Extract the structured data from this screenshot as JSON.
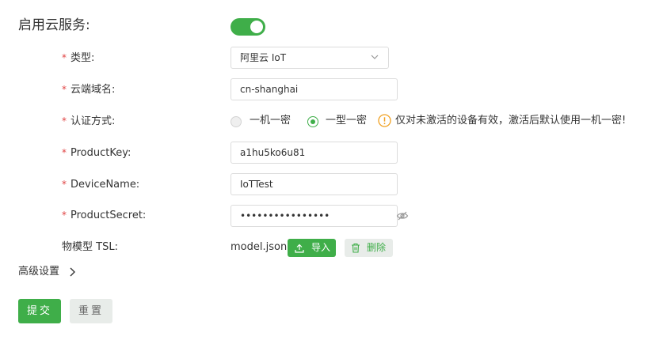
{
  "cloud_service": {
    "label": "启用云服务:",
    "enabled": true
  },
  "form": {
    "type": {
      "label": "类型:",
      "value": "阿里云 IoT"
    },
    "domain": {
      "label": "云端域名:",
      "value": "cn-shanghai"
    },
    "auth": {
      "label": "认证方式:",
      "options": [
        "一机一密",
        "一型一密"
      ],
      "selected": "一型一密",
      "warning": "仅对未激活的设备有效，激活后默认使用一机一密!"
    },
    "product_key": {
      "label": "ProductKey:",
      "value": "a1hu5ko6u81"
    },
    "device_name": {
      "label": "DeviceName:",
      "value": "IoTTest"
    },
    "product_secret": {
      "label": "ProductSecret:",
      "value": "••••••••••••••••"
    },
    "tsl": {
      "label": "物模型 TSL:",
      "file": "model.json",
      "import_label": "导入",
      "delete_label": "删除"
    }
  },
  "advanced": {
    "label": "高级设置"
  },
  "actions": {
    "submit": "提交",
    "reset": "重置"
  },
  "colors": {
    "accent": "#3fae49",
    "required": "#e04343",
    "warning": "#f0a020"
  }
}
